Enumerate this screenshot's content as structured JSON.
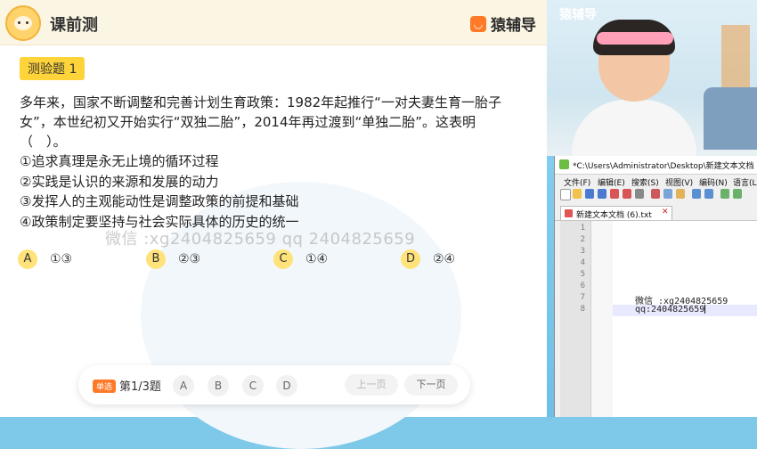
{
  "header": {
    "title": "课前测",
    "brand": "猿辅导",
    "brand_icon": "yuan-logo-icon"
  },
  "quiz": {
    "tag": "测验题 1",
    "question": "多年来，国家不断调整和完善计划生育政策：1982年起推行“一对夫妻生育一胎子女”，本世纪初又开始实行“双独二胎”，2014年再过渡到“单独二胎”。这表明（　）。",
    "options": [
      "①追求真理是永无止境的循环过程",
      "②实践是认识的来源和发展的动力",
      "③发挥人的主观能动性是调整政策的前提和基础",
      "④政策制定要坚持与社会实际具体的历史的统一"
    ],
    "choices": [
      {
        "letter": "A",
        "text": "①③"
      },
      {
        "letter": "B",
        "text": "②③"
      },
      {
        "letter": "C",
        "text": "①④"
      },
      {
        "letter": "D",
        "text": "②④"
      }
    ],
    "watermark": "微信 :xg2404825659  qq 2404825659"
  },
  "bottom_bar": {
    "type_label": "单选",
    "progress": "第1/3题",
    "answers": [
      "A",
      "B",
      "C",
      "D"
    ],
    "prev": "上一页",
    "next": "下一页"
  },
  "video": {
    "logo": "猿辅导"
  },
  "editor": {
    "title": "*C:\\Users\\Administrator\\Desktop\\新建文本文档 (",
    "menu": [
      "文件(F)",
      "编辑(E)",
      "搜索(S)",
      "视图(V)",
      "编码(N)",
      "语言(L"
    ],
    "tab_label": "新建文本文档 (6).txt",
    "line_numbers": [
      "1",
      "2",
      "3",
      "4",
      "5",
      "6",
      "7",
      "8"
    ],
    "lines": {
      "line7": "微信 :xg2404825659",
      "line8": "qq:2404825659"
    }
  },
  "colors": {
    "accent": "#ffd43a",
    "brand_orange": "#ff7a28"
  }
}
